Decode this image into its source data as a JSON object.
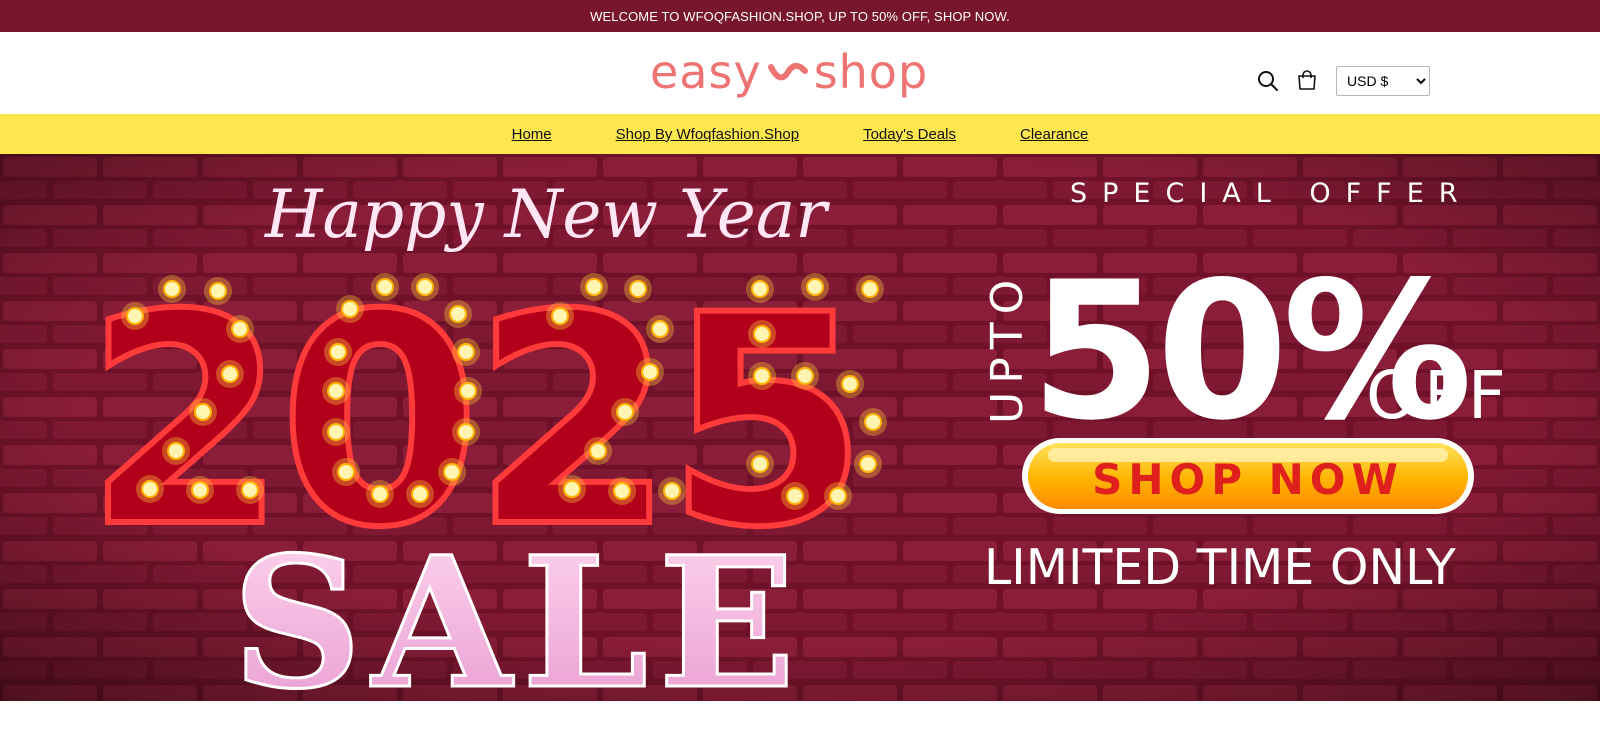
{
  "announcement": "WELCOME TO WFOQFASHION.SHOP, UP TO 50% OFF, SHOP NOW.",
  "logo": {
    "left": "easy",
    "right": "shop",
    "color": "#ee7474",
    "icon": "swoosh-icon"
  },
  "header": {
    "search_icon": "search-icon",
    "cart_icon": "cart-icon",
    "currency": "USD $"
  },
  "nav": {
    "items": [
      {
        "label": "Home"
      },
      {
        "label": "Shop By Wfoqfashion.Shop"
      },
      {
        "label": "Today's Deals"
      },
      {
        "label": "Clearance"
      }
    ]
  },
  "hero": {
    "script": "Happy New Year",
    "year": "2025",
    "sale": "SALE",
    "special_offer": "SPECIAL OFFER",
    "upto": "UPTO",
    "percent": "50%",
    "off": "OFF",
    "cta": "SHOP NOW",
    "limited": "LIMITED TIME ONLY"
  },
  "colors": {
    "announcement_bg": "#78172c",
    "nav_bg": "#fde74f",
    "hero_bg": "#6a0f26",
    "cta_bg": "#ffb400",
    "cta_text": "#e0201c"
  }
}
